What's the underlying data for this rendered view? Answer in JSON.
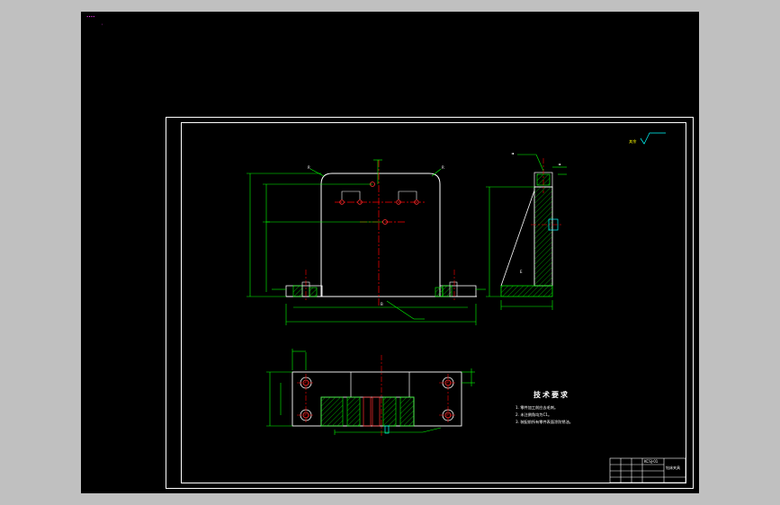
{
  "viewport": {
    "background": "#000000",
    "app_background": "#c0c0c0",
    "corner_label": "••••"
  },
  "colors": {
    "border": "#ffffff",
    "dimension": "#00ff00",
    "centerline": "#ff0000",
    "hatch": "#00ff00",
    "part_outline": "#ffffff",
    "hole": "#ff3030",
    "accent": "#00ffff",
    "yellow": "#ffff00"
  },
  "technical_requirements": {
    "title": "技术要求",
    "items": [
      "1. 零件加工前应去毛刺。",
      "2. 未注倒角均为C1。",
      "3. 装配前所有零件表面涂防锈油。"
    ]
  },
  "roughness_note": "其余",
  "title_block": {
    "drawing_name": "钻床夹具",
    "code": "KCSJ-01"
  },
  "icons": {
    "roughness": "surface-roughness-icon",
    "section_arrow": "section-arrow-icon"
  }
}
